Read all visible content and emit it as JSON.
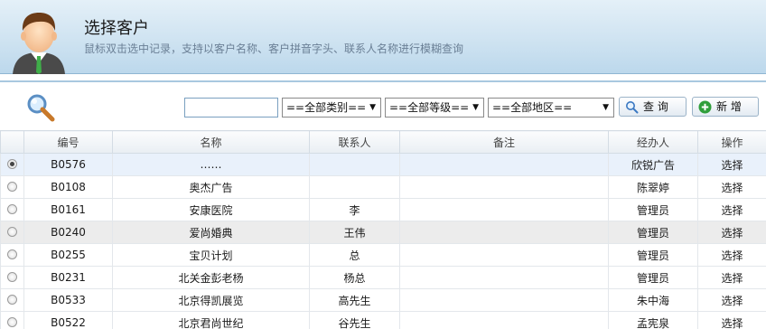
{
  "header": {
    "title": "选择客户",
    "subtitle": "鼠标双击选中记录，支持以客户名称、客户拼音字头、联系人名称进行模糊查询"
  },
  "toolbar": {
    "search_value": "",
    "category_select": "==全部类别==",
    "level_select": "==全部等级==",
    "region_select": "==全部地区==",
    "query_label": "查 询",
    "add_label": "新 增"
  },
  "table": {
    "columns": [
      "编号",
      "名称",
      "联系人",
      "备注",
      "经办人",
      "操作"
    ],
    "rows": [
      {
        "code": "B0576",
        "name": "……",
        "contact": "",
        "note": "",
        "handler": "欣锐广告",
        "action": "选择"
      },
      {
        "code": "B0108",
        "name": "奥杰广告",
        "contact": "",
        "note": "",
        "handler": "陈翠婷",
        "action": "选择"
      },
      {
        "code": "B0161",
        "name": "安康医院",
        "contact": "李",
        "note": "",
        "handler": "管理员",
        "action": "选择"
      },
      {
        "code": "B0240",
        "name": "爱尚婚典",
        "contact": "王伟",
        "note": "",
        "handler": "管理员",
        "action": "选择"
      },
      {
        "code": "B0255",
        "name": "宝贝计划",
        "contact": "总",
        "note": "",
        "handler": "管理员",
        "action": "选择"
      },
      {
        "code": "B0231",
        "name": "北关金彭老杨",
        "contact": "杨总",
        "note": "",
        "handler": "管理员",
        "action": "选择"
      },
      {
        "code": "B0533",
        "name": "北京得凯展览",
        "contact": "高先生",
        "note": "",
        "handler": "朱中海",
        "action": "选择"
      },
      {
        "code": "B0522",
        "name": "北京君尚世纪",
        "contact": "谷先生",
        "note": "",
        "handler": "孟宪泉",
        "action": "选择"
      }
    ]
  },
  "icons": {
    "avatar": "user-avatar-icon",
    "search": "magnifier-icon",
    "query": "search-icon",
    "add": "plus-icon"
  },
  "colors": {
    "header_bg": "#cfe3f1",
    "link": "#1f4f9a",
    "selected_row": "#e9f1fb",
    "add_icon": "#2f9e3a"
  }
}
